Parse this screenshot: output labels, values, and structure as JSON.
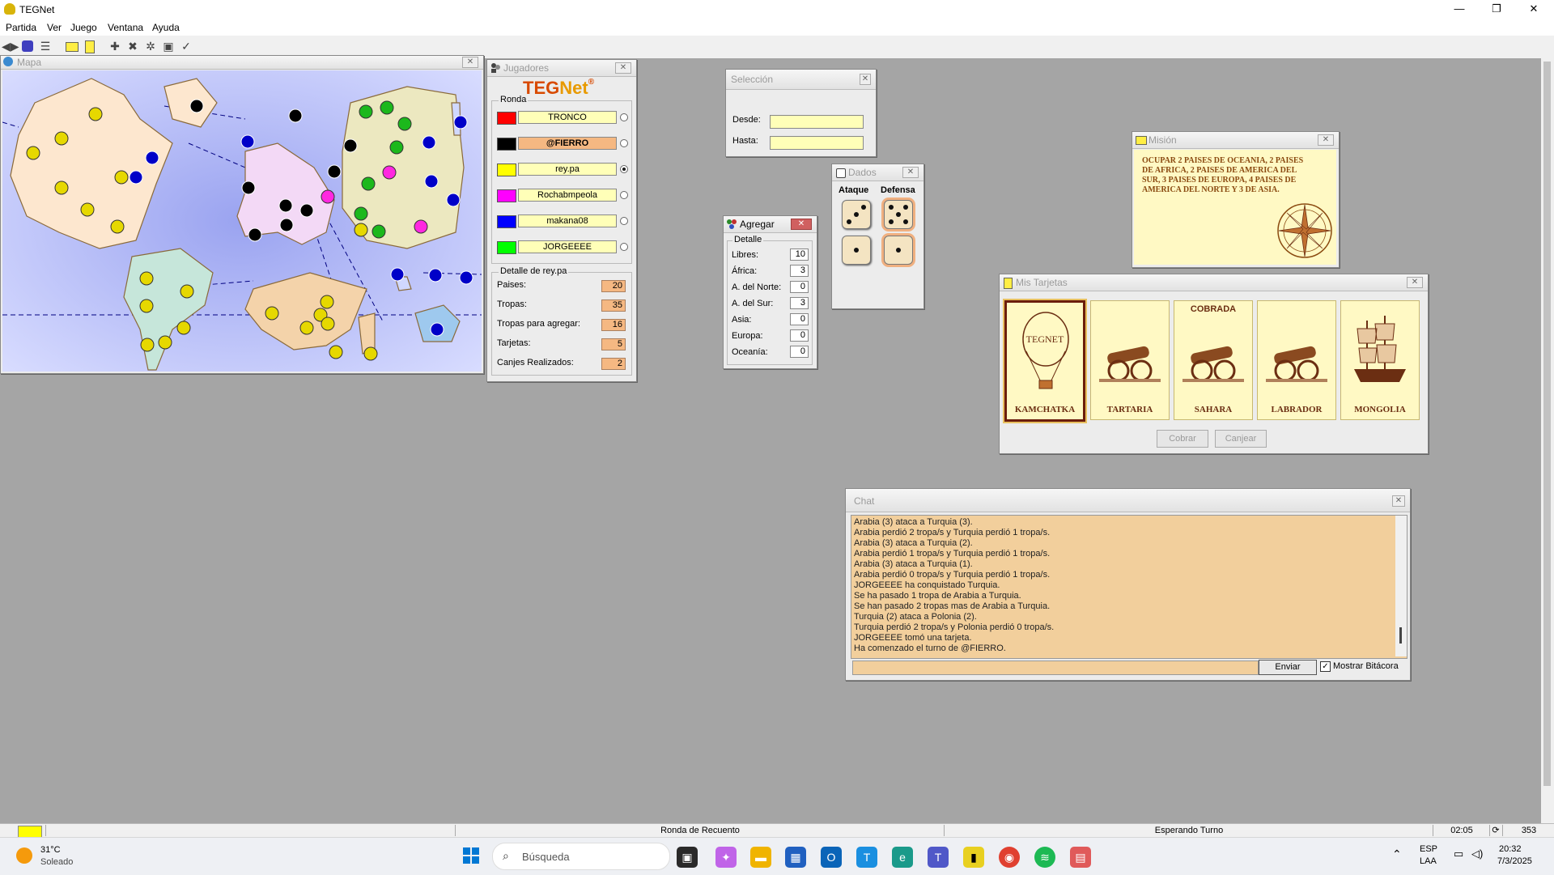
{
  "app": {
    "title": "TEGNet"
  },
  "window_controls": {
    "minimize": "—",
    "maximize": "❐",
    "close": "✕"
  },
  "menu": [
    "Partida",
    "Ver",
    "Juego",
    "Ventana",
    "Ayuda"
  ],
  "mapa": {
    "title": "Mapa"
  },
  "jugadores": {
    "title": "Jugadores",
    "logo_teg": "TEG",
    "logo_net": "Net",
    "logo_mark": "®",
    "ronda_label": "Ronda",
    "players": [
      {
        "name": "TRONCO",
        "color": "#ff0000",
        "highlight": false,
        "selected": false
      },
      {
        "name": "@FIERRO",
        "color": "#000000",
        "highlight": true,
        "selected": false
      },
      {
        "name": "rey.pa",
        "color": "#ffff00",
        "highlight": false,
        "selected": true
      },
      {
        "name": "Rochabmpeola",
        "color": "#ff00ff",
        "highlight": false,
        "selected": false
      },
      {
        "name": "makana08",
        "color": "#0000ff",
        "highlight": false,
        "selected": false
      },
      {
        "name": "JORGEEEE",
        "color": "#00ff00",
        "highlight": false,
        "selected": false
      }
    ],
    "detalle_label": "Detalle de rey.pa",
    "detalle": [
      {
        "label": "Paises:",
        "value": "20"
      },
      {
        "label": "Tropas:",
        "value": "35"
      },
      {
        "label": "Tropas para agregar:",
        "value": "16"
      },
      {
        "label": "Tarjetas:",
        "value": "5"
      },
      {
        "label": "Canjes Realizados:",
        "value": "2"
      }
    ]
  },
  "seleccion": {
    "title": "Selección",
    "desde_label": "Desde:",
    "desde_value": "",
    "hasta_label": "Hasta:",
    "hasta_value": ""
  },
  "dados": {
    "title": "Dados",
    "ataque_label": "Ataque",
    "defensa_label": "Defensa",
    "ataque": [
      3,
      1
    ],
    "defensa": [
      5,
      1
    ]
  },
  "agregar": {
    "title": "Agregar",
    "detalle_label": "Detalle",
    "rows": [
      {
        "label": "Libres:",
        "value": "10"
      },
      {
        "label": "África:",
        "value": "3"
      },
      {
        "label": "A. del Norte:",
        "value": "0"
      },
      {
        "label": "A. del Sur:",
        "value": "3"
      },
      {
        "label": "Asia:",
        "value": "0"
      },
      {
        "label": "Europa:",
        "value": "0"
      },
      {
        "label": "Oceanía:",
        "value": "0"
      }
    ]
  },
  "mision": {
    "title": "Misión",
    "text": "OCUPAR 2 PAISES DE OCEANIA, 2 PAISES DE AFRICA, 2 PAISES DE AMERICA DEL SUR, 3 PAISES DE EUROPA, 4 PAISES DE AMERICA DEL NORTE Y 3 DE ASIA."
  },
  "tarjetas": {
    "title": "Mis Tarjetas",
    "cards": [
      {
        "name": "KAMCHATKA",
        "kind": "balloon",
        "balloon_text": "TEGNET",
        "cobrada": "",
        "selected": true
      },
      {
        "name": "TARTARIA",
        "kind": "cannon",
        "cobrada": "",
        "selected": false
      },
      {
        "name": "SAHARA",
        "kind": "cannon",
        "cobrada": "COBRADA",
        "selected": false
      },
      {
        "name": "LABRADOR",
        "kind": "cannon",
        "cobrada": "",
        "selected": false
      },
      {
        "name": "MONGOLIA",
        "kind": "ship",
        "cobrada": "",
        "selected": false
      }
    ],
    "cobrar_label": "Cobrar",
    "canjear_label": "Canjear"
  },
  "chat": {
    "title": "Chat",
    "lines": [
      "Arabia (3) ataca a Turquia (3).",
      "Arabia perdió 2 tropa/s y Turquia perdió 1 tropa/s.",
      "Arabia (3) ataca a Turquia (2).",
      "Arabia perdió 1 tropa/s y Turquia perdió 1 tropa/s.",
      "Arabia (3) ataca a Turquia (1).",
      "Arabia perdió 0 tropa/s y Turquia perdió 1 tropa/s.",
      "JORGEEEE ha conquistado Turquia.",
      "Se ha pasado 1 tropa de Arabia a Turquia.",
      "Se han pasado 2 tropas mas de Arabia a Turquia.",
      "Turquia (2) ataca a Polonia (2).",
      "Turquia perdió 2 tropa/s y Polonia perdió 0 tropa/s.",
      "JORGEEEE tomó una tarjeta.",
      "Ha comenzado el turno de @FIERRO."
    ],
    "input_value": "",
    "enviar_label": "Enviar",
    "mostrar_label": "Mostrar Bitácora",
    "mostrar_checked": true
  },
  "status": {
    "ronda": "Ronda de Recuento",
    "estado": "Esperando Turno",
    "time": "02:05",
    "count": "353",
    "color": "#ffff00"
  },
  "taskbar": {
    "weather_temp": "31°C",
    "weather_desc": "Soleado",
    "search_placeholder": "Búsqueda",
    "lang": "ESP",
    "lang2": "LAA",
    "clock_time": "20:32",
    "clock_date": "7/3/2025"
  }
}
